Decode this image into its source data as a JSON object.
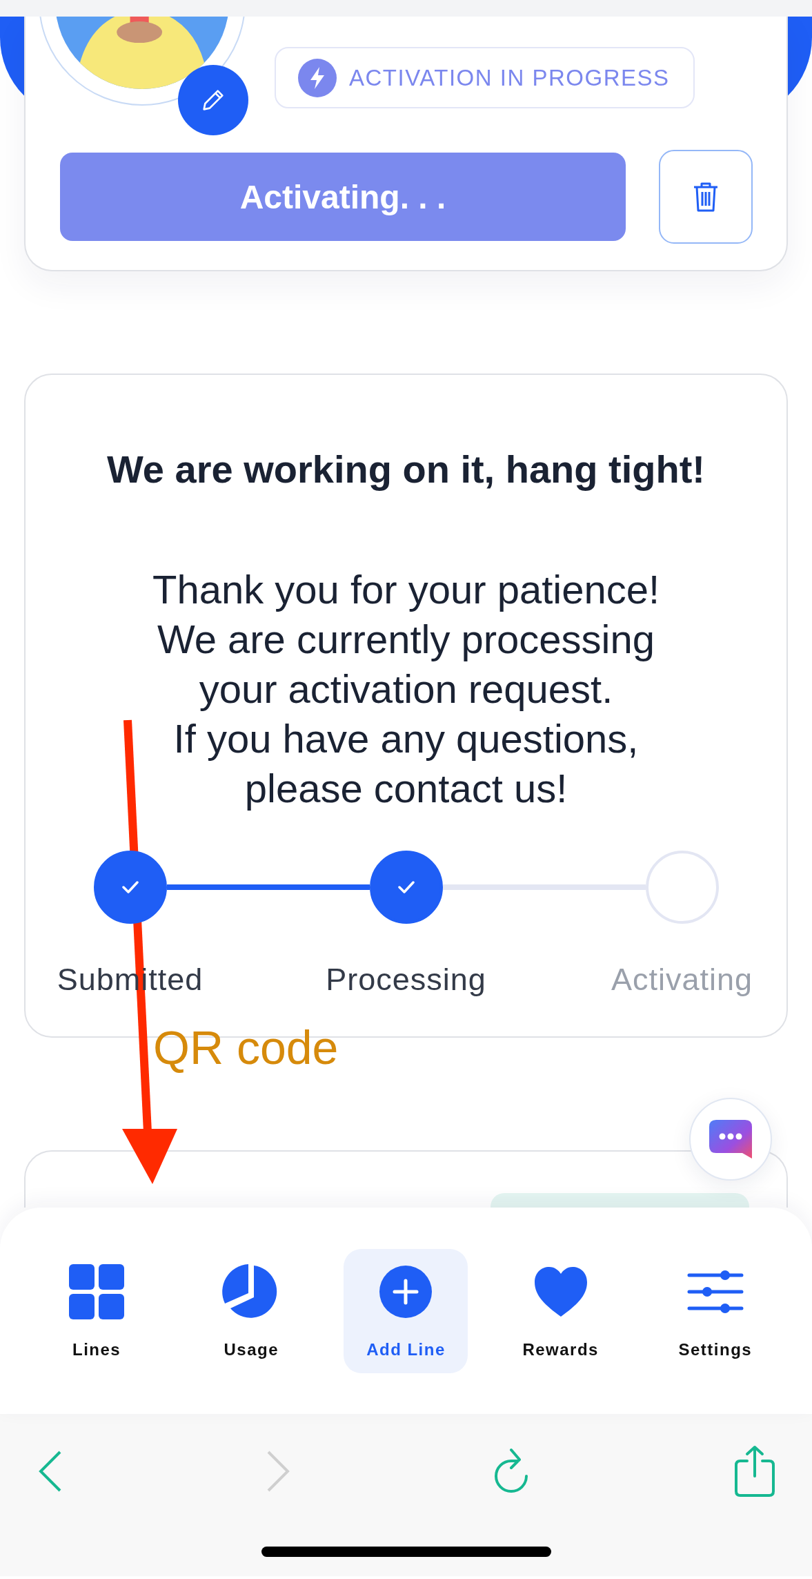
{
  "status_badge": {
    "label": "ACTIVATION IN PROGRESS"
  },
  "activate_button": {
    "label": "Activating. . ."
  },
  "status_card": {
    "title": "We are working on it, hang tight!",
    "message": "Thank you for your patience!\nWe are currently processing\nyour activation request.\nIf you have any questions,\nplease contact us!"
  },
  "steps": [
    {
      "label": "Submitted",
      "done": true
    },
    {
      "label": "Processing",
      "done": true
    },
    {
      "label": "Activating",
      "done": false
    }
  ],
  "annotation": {
    "label": "QR code"
  },
  "nav": [
    {
      "label": "Lines",
      "kind": "grid",
      "selected": false
    },
    {
      "label": "Usage",
      "kind": "pie",
      "selected": false
    },
    {
      "label": "Add Line",
      "kind": "plus",
      "selected": true
    },
    {
      "label": "Rewards",
      "kind": "heart",
      "selected": false
    },
    {
      "label": "Settings",
      "kind": "sliders",
      "selected": false
    }
  ],
  "browser_buttons": [
    {
      "kind": "back",
      "disabled": false
    },
    {
      "kind": "forward",
      "disabled": true
    },
    {
      "kind": "reload",
      "disabled": false
    },
    {
      "kind": "share",
      "disabled": false
    }
  ]
}
